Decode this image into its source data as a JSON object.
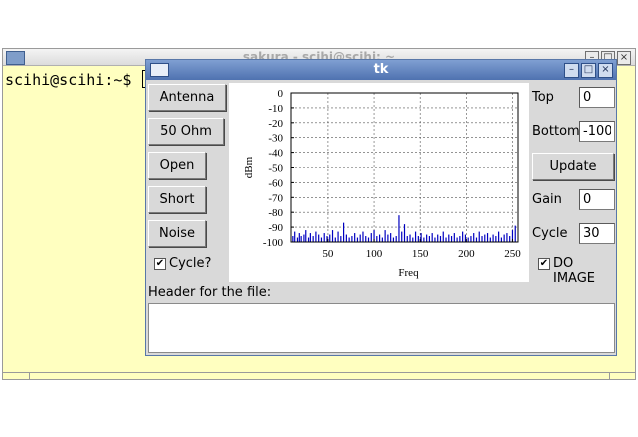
{
  "terminal": {
    "title": "sakura - scihi@scihi: ~",
    "prompt": "scihi@scihi:~$"
  },
  "tk": {
    "title": "tk",
    "buttons": {
      "antenna": "Antenna",
      "ohm50": "50 Ohm",
      "open": "Open",
      "short": "Short",
      "noise": "Noise",
      "update": "Update"
    },
    "cycle_check": {
      "label": "Cycle?",
      "checked": true
    },
    "do_image_check": {
      "label": "DO IMAGE",
      "checked": true
    },
    "fields": {
      "top_label": "Top",
      "top_value": "0",
      "bottom_label": "Bottom",
      "bottom_value": "-100",
      "gain_label": "Gain",
      "gain_value": "0",
      "cycle_label": "Cycle",
      "cycle_value": "30"
    },
    "header_label": "Header for the file:",
    "header_value": ""
  },
  "chart_data": {
    "type": "bar",
    "xlabel": "Freq",
    "ylabel": "dBm",
    "xlim": [
      10,
      256
    ],
    "ylim": [
      -100,
      0
    ],
    "xticks": [
      50,
      100,
      150,
      200,
      250
    ],
    "yticks": [
      0,
      -10,
      -20,
      -30,
      -40,
      -50,
      -60,
      -70,
      -80,
      -90,
      -100
    ],
    "grid": true,
    "bar_color": "#0000c0",
    "x": [
      12,
      14,
      17,
      19,
      21,
      24,
      26,
      29,
      31,
      34,
      37,
      40,
      43,
      46,
      49,
      52,
      55,
      58,
      61,
      64,
      67,
      70,
      73,
      76,
      79,
      82,
      85,
      88,
      91,
      94,
      97,
      100,
      103,
      106,
      109,
      112,
      115,
      118,
      121,
      124,
      127,
      130,
      133,
      136,
      139,
      142,
      145,
      148,
      151,
      154,
      157,
      160,
      163,
      166,
      169,
      172,
      175,
      178,
      181,
      184,
      187,
      190,
      193,
      196,
      199,
      202,
      205,
      208,
      211,
      214,
      217,
      220,
      223,
      226,
      229,
      232,
      235,
      238,
      241,
      244,
      247,
      250,
      253
    ],
    "values": [
      -96,
      -93,
      -97,
      -94,
      -96,
      -95,
      -92,
      -97,
      -94,
      -96,
      -93,
      -95,
      -97,
      -94,
      -96,
      -95,
      -92,
      -97,
      -93,
      -96,
      -87,
      -95,
      -97,
      -96,
      -94,
      -97,
      -95,
      -93,
      -96,
      -97,
      -94,
      -92,
      -96,
      -95,
      -97,
      -92,
      -95,
      -94,
      -97,
      -96,
      -82,
      -93,
      -88,
      -96,
      -95,
      -97,
      -93,
      -96,
      -94,
      -97,
      -95,
      -96,
      -94,
      -97,
      -95,
      -96,
      -93,
      -97,
      -95,
      -96,
      -94,
      -97,
      -96,
      -93,
      -95,
      -97,
      -96,
      -94,
      -97,
      -93,
      -96,
      -95,
      -94,
      -97,
      -95,
      -96,
      -93,
      -97,
      -95,
      -94,
      -96,
      -92,
      -89
    ]
  }
}
